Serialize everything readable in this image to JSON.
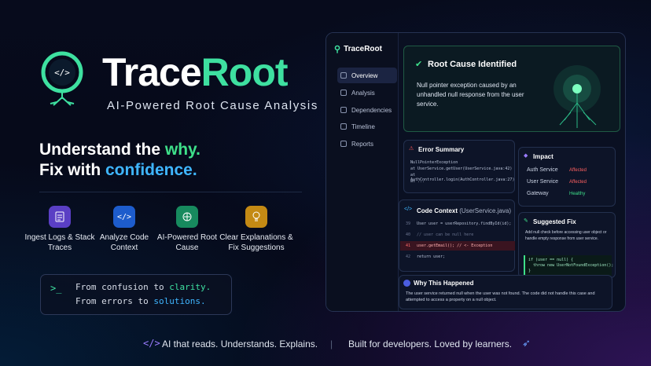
{
  "brand": {
    "name_a": "Trace",
    "name_b": "Root",
    "tagline": "AI-Powered Root Cause Analysis"
  },
  "headline": {
    "l1_a": "Understand the ",
    "l1_b": "why.",
    "l2_a": "Fix with ",
    "l2_b": "confidence."
  },
  "features": [
    {
      "label": "Ingest Logs & Stack Traces",
      "icon": "document-icon",
      "color": "#6a4bd8"
    },
    {
      "label": "Analyze Code Context",
      "icon": "code-icon",
      "color": "#1f63d6"
    },
    {
      "label": "AI-Powered Root Cause",
      "icon": "brain-icon",
      "color": "#1c9a6a"
    },
    {
      "label": "Clear Explanations & Fix Suggestions",
      "icon": "lightbulb-icon",
      "color": "#d49a1c"
    }
  ],
  "terminal": {
    "prompt": ">_",
    "line1_a": "From confusion to ",
    "line1_b": "clarity.",
    "line2_a": "From errors to ",
    "line2_b": "solutions."
  },
  "footer": {
    "left": "AI that reads. Understands. Explains.",
    "divider": "|",
    "right": "Built for developers. Loved by learners."
  },
  "app": {
    "logo": "TraceRoot",
    "nav": [
      "Overview",
      "Analysis",
      "Dependencies",
      "Timeline",
      "Reports"
    ],
    "root": {
      "title": "Root Cause Identified",
      "body": "Null pointer exception caused by an unhandled null response from the user service."
    },
    "error": {
      "title": "Error Summary",
      "lines": [
        "NullPointerException",
        "at UserService.getUser(UserService.java:42)",
        "at AuthController.login(AuthController.java:27)",
        "at ..."
      ]
    },
    "impact": {
      "title": "Impact",
      "rows": [
        {
          "name": "Auth Service",
          "status": "Affected"
        },
        {
          "name": "User Service",
          "status": "Affected"
        },
        {
          "name": "Gateway",
          "status": "Healthy"
        }
      ]
    },
    "code": {
      "title": "Code Context",
      "file": "(UserService.java)",
      "lines": [
        {
          "n": "39",
          "t": "User user = userRepository.findById(id);"
        },
        {
          "n": "40",
          "t": "// user can be null here"
        },
        {
          "n": "41",
          "t": "user.getEmail();  // <- Exception"
        },
        {
          "n": "42",
          "t": "return user;"
        }
      ]
    },
    "fix": {
      "title": "Suggested Fix",
      "body": "Add null check before accessing user object or handle empty response from user service.",
      "code1": "if (user == null) {",
      "code2": "throw new UserNotFoundException();",
      "code3": "}"
    },
    "why": {
      "title": "Why This Happened",
      "body": "The user service returned null when the user was not found. The code did not handle this case and attempted to access a property on a null object."
    }
  }
}
